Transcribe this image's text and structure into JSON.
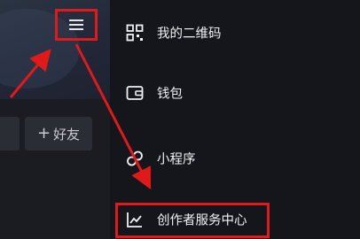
{
  "profile": {
    "add_friend_label": "好友",
    "add_friend_icon": "plus-icon",
    "menu_icon": "hamburger-menu-icon"
  },
  "drawer": {
    "items": [
      {
        "label": "我的二维码",
        "icon": "qr-code-icon"
      },
      {
        "label": "钱包",
        "icon": "wallet-icon"
      },
      {
        "label": "小程序",
        "icon": "mini-program-icon"
      },
      {
        "label": "创作者服务中心",
        "icon": "creator-chart-icon"
      }
    ]
  },
  "colors": {
    "annotation_red": "#e01919",
    "drawer_background": "#15161b",
    "text_primary": "#f1f1f3"
  }
}
